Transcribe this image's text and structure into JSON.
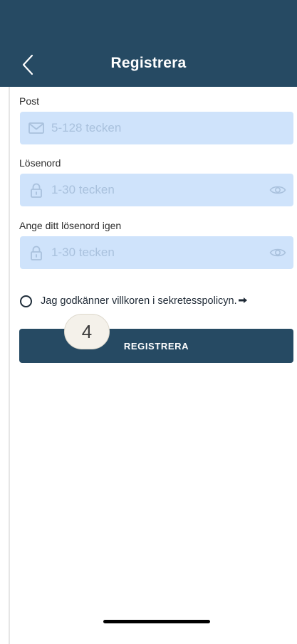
{
  "header": {
    "title": "Registrera",
    "back_icon": "chevron-left-icon"
  },
  "form": {
    "email": {
      "label": "Post",
      "placeholder": "5-128 tecken",
      "icon": "mail-icon"
    },
    "password": {
      "label": "Lösenord",
      "placeholder": "1-30 tecken",
      "icon": "lock-icon",
      "toggle_icon": "eye-icon"
    },
    "confirm_password": {
      "label": "Ange ditt lösenord igen",
      "placeholder": "1-30 tecken",
      "icon": "lock-icon",
      "toggle_icon": "eye-icon"
    },
    "consent": {
      "text": "Jag godkänner villkoren i sekretesspolicyn.",
      "checked": false,
      "link_icon": "arrow-right-icon"
    },
    "submit_label": "REGISTRERA"
  },
  "overlay": {
    "step_number": "4"
  },
  "colors": {
    "header_bg": "#264a63",
    "field_bg": "#cfe3fb",
    "placeholder": "#a9c1dd",
    "button_bg": "#264a63",
    "button_text": "#ffffff"
  }
}
